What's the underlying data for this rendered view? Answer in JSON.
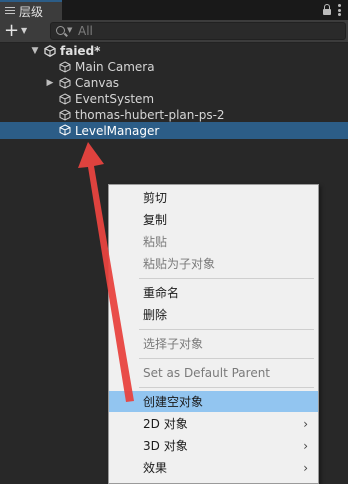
{
  "panel": {
    "tab_title": "层级"
  },
  "toolbar": {
    "add_label": "+",
    "search_placeholder": "All"
  },
  "hierarchy": {
    "scene_name": "faied*",
    "items": [
      {
        "label": "Main Camera",
        "has_children": false,
        "selected": false
      },
      {
        "label": "Canvas",
        "has_children": true,
        "selected": false
      },
      {
        "label": "EventSystem",
        "has_children": false,
        "selected": false
      },
      {
        "label": "thomas-hubert-plan-ps-2",
        "has_children": false,
        "selected": false
      },
      {
        "label": "LevelManager",
        "has_children": false,
        "selected": true
      }
    ]
  },
  "context_menu": {
    "items": [
      {
        "label": "剪切",
        "disabled": false
      },
      {
        "label": "复制",
        "disabled": false
      },
      {
        "label": "粘贴",
        "disabled": true
      },
      {
        "label": "粘贴为子对象",
        "disabled": true
      },
      {
        "label": "重命名",
        "disabled": false
      },
      {
        "label": "删除",
        "disabled": false
      },
      {
        "label": "选择子对象",
        "disabled": true
      },
      {
        "label": "Set as Default Parent",
        "disabled": true
      },
      {
        "label": "创建空对象",
        "disabled": false,
        "highlighted": true
      },
      {
        "label": "2D 对象",
        "disabled": false,
        "submenu": true
      },
      {
        "label": "3D 对象",
        "disabled": false,
        "submenu": true
      },
      {
        "label": "效果",
        "disabled": false,
        "submenu": true
      }
    ],
    "submenu_glyph": "›"
  },
  "colors": {
    "selection": "#2c5d87",
    "menu_highlight": "#92c5f0",
    "annotation_arrow": "#e8433f"
  }
}
